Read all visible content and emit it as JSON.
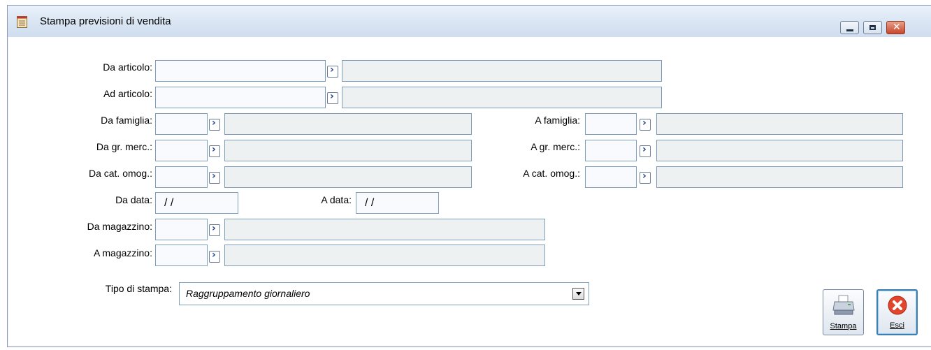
{
  "window": {
    "title": "Stampa previsioni di vendita"
  },
  "fields": {
    "da_articolo": {
      "label": "Da articolo:"
    },
    "ad_articolo": {
      "label": "Ad articolo:"
    },
    "da_famiglia": {
      "label": "Da famiglia:"
    },
    "a_famiglia": {
      "label": "A famiglia:"
    },
    "da_gr_merc": {
      "label": "Da gr. merc.:"
    },
    "a_gr_merc": {
      "label": "A gr. merc.:"
    },
    "da_cat_omog": {
      "label": "Da cat. omog.:"
    },
    "a_cat_omog": {
      "label": "A cat. omog.:"
    },
    "da_data": {
      "label": "Da data:",
      "value": "/ /"
    },
    "a_data": {
      "label": "A data:",
      "value": "/ /"
    },
    "da_magazzino": {
      "label": "Da magazzino:"
    },
    "a_magazzino": {
      "label": "A magazzino:"
    }
  },
  "tipo_stampa": {
    "label": "Tipo di stampa:",
    "value": "Raggruppamento giornaliero"
  },
  "buttons": {
    "stampa": {
      "label": "Stampa",
      "icon": "printer-icon"
    },
    "esci": {
      "label": "Esci",
      "icon": "close-icon"
    }
  },
  "icons": {
    "app": "document-icon",
    "minimize": "minimize-icon",
    "restore": "restore-icon",
    "close": "close-icon"
  }
}
